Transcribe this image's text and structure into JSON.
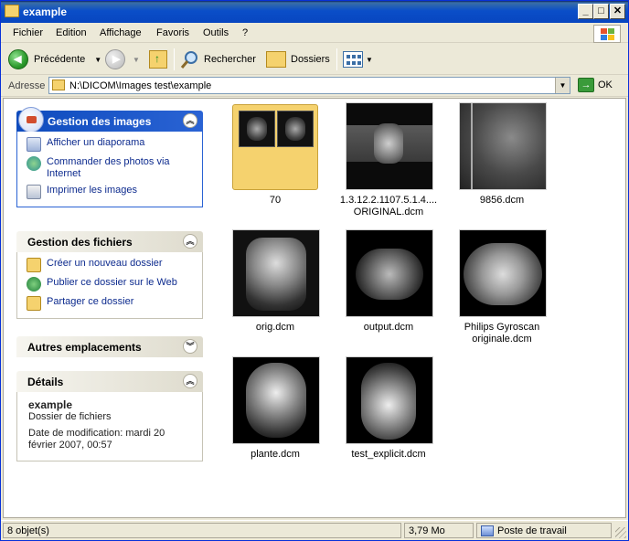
{
  "window": {
    "title": "example"
  },
  "menu": [
    {
      "label": "Fichier"
    },
    {
      "label": "Edition"
    },
    {
      "label": "Affichage"
    },
    {
      "label": "Favoris"
    },
    {
      "label": "Outils"
    },
    {
      "label": "?"
    }
  ],
  "toolbar": {
    "back_label": "Précédente",
    "search_label": "Rechercher",
    "folders_label": "Dossiers"
  },
  "address": {
    "label": "Adresse",
    "path": "N:\\DICOM\\Images test\\example",
    "go_label": "OK"
  },
  "panels": {
    "images": {
      "title": "Gestion des images",
      "tasks": [
        "Afficher un diaporama",
        "Commander des photos via Internet",
        "Imprimer les images"
      ]
    },
    "files": {
      "title": "Gestion des fichiers",
      "tasks": [
        "Créer un nouveau dossier",
        "Publier ce dossier sur le Web",
        "Partager ce dossier"
      ]
    },
    "places": {
      "title": "Autres emplacements"
    },
    "details": {
      "title": "Détails",
      "name": "example",
      "type": "Dossier de fichiers",
      "modified": "Date de modification: mardi 20 février 2007, 00:57"
    }
  },
  "files": [
    {
      "name": "70",
      "kind": "folder"
    },
    {
      "name_line1": "1.3.12.2.1107.5.1.4....",
      "name_line2": "ORIGINAL.dcm",
      "kind": "image"
    },
    {
      "name": "9856.dcm",
      "kind": "image"
    },
    {
      "name": "orig.dcm",
      "kind": "image"
    },
    {
      "name": "output.dcm",
      "kind": "image"
    },
    {
      "name_line1": "Philips Gyroscan",
      "name_line2": "originale.dcm",
      "kind": "image"
    },
    {
      "name": "plante.dcm",
      "kind": "image"
    },
    {
      "name": "test_explicit.dcm",
      "kind": "image"
    }
  ],
  "status": {
    "count": "8 objet(s)",
    "size": "3,79 Mo",
    "zone": "Poste de travail"
  },
  "colors": {
    "title_blue": "#0a4ec8",
    "link_blue": "#0d2b8e",
    "chrome": "#ece9d8"
  }
}
